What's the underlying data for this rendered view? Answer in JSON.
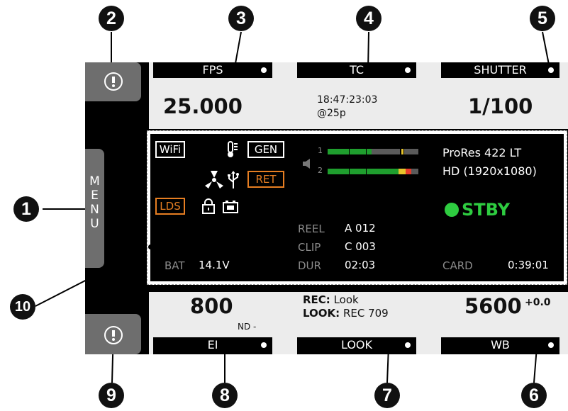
{
  "callouts": [
    "1",
    "2",
    "3",
    "4",
    "5",
    "6",
    "7",
    "8",
    "9",
    "10"
  ],
  "side": {
    "menu_letters": [
      "M",
      "E",
      "N",
      "U"
    ]
  },
  "top_tabs": {
    "fps": "FPS",
    "tc": "TC",
    "shutter": "SHUTTER"
  },
  "top_values": {
    "fps": "25.000",
    "tc_time": "18:47:23:03",
    "tc_rate": "@25p",
    "shutter": "1/100"
  },
  "status": {
    "wifi": "WiFi",
    "gen": "GEN",
    "ret": "RET",
    "lds": "LDS",
    "audio_ch1": "1",
    "audio_ch2": "2",
    "codec": "ProRes 422 LT",
    "resolution": "HD (1920x1080)",
    "rec_state": "STBY",
    "reel_label": "REEL",
    "reel_value": "A 012",
    "clip_label": "CLIP",
    "clip_value": "C 003",
    "dur_label": "DUR",
    "dur_value": "02:03",
    "bat_label": "BAT",
    "bat_value": "14.1V",
    "card_label": "CARD",
    "card_value": "0:39:01"
  },
  "bottom_values": {
    "ei": "800",
    "nd": "ND -",
    "rec_label": "REC:",
    "rec_value": "Look",
    "look_label": "LOOK:",
    "look_value": "REC 709",
    "wb": "5600",
    "wb_offset": "+0.0"
  },
  "bottom_tabs": {
    "ei": "EI",
    "look": "LOOK",
    "wb": "WB"
  },
  "icons": [
    "info-icon",
    "fan-icon",
    "thermometer-icon",
    "usb-icon",
    "lock-icon",
    "battery-icon",
    "speaker-icon"
  ],
  "colors": {
    "accent_orange": "#e67e22",
    "standby_green": "#2ecc40",
    "panel_grey": "#ececec"
  }
}
